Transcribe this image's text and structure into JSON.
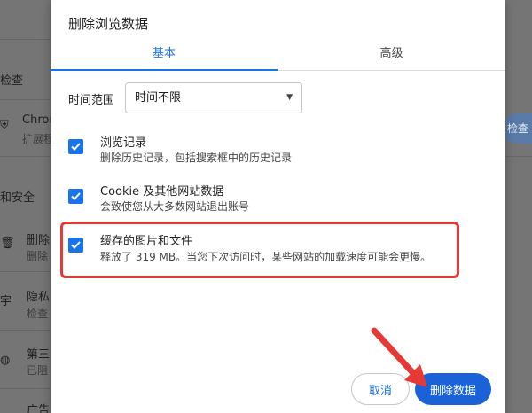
{
  "background": {
    "section1": "检查",
    "chrome_label": "Chrom",
    "chrome_sub": "扩展程",
    "section2": "和安全",
    "item1": "删除",
    "item1_sub": "删除",
    "item2": "隐私",
    "item2_sub": "检查",
    "item3": "第三",
    "item3_sub": "已阻",
    "item4": "广告",
    "side_button": "检查"
  },
  "dialog": {
    "title": "删除浏览数据",
    "tabs": [
      {
        "label": "基本",
        "active": true
      },
      {
        "label": "高级",
        "active": false
      }
    ],
    "time_range_label": "时间范围",
    "time_range_value": "时间不限",
    "options": [
      {
        "title": "浏览记录",
        "desc": "删除历史记录，包括搜索框中的历史记录",
        "checked": true
      },
      {
        "title": "Cookie 及其他网站数据",
        "desc": "会致使您从大多数网站退出账号",
        "checked": true
      },
      {
        "title": "缓存的图片和文件",
        "desc": "释放了 319 MB。当您下次访问时，某些网站的加载速度可能会更慢。",
        "checked": true
      }
    ],
    "cancel_label": "取消",
    "delete_label": "删除数据"
  },
  "colors": {
    "accent": "#1a73e8",
    "delete_button": "#1a62d6",
    "annotation_red": "#e53935"
  }
}
